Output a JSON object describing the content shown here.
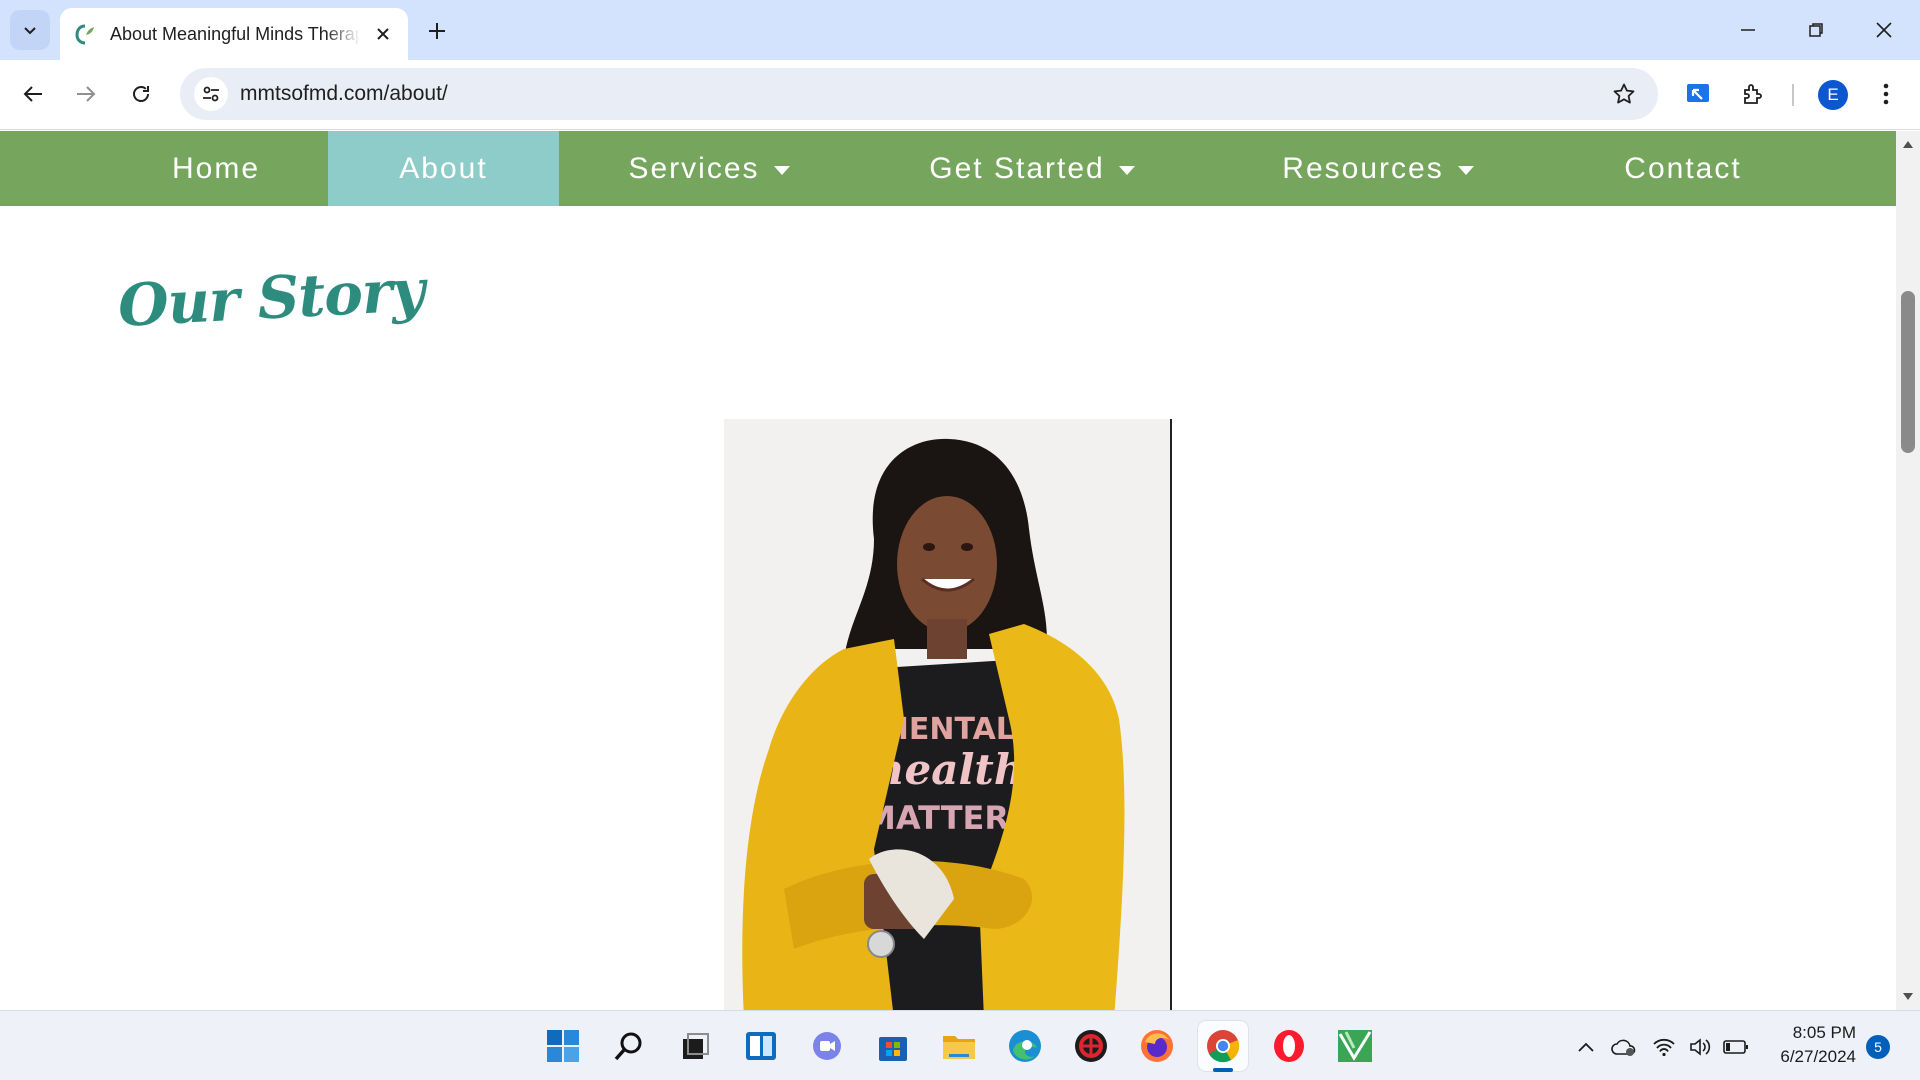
{
  "browser": {
    "tab_title": "About Meaningful Minds Therapy",
    "url": "mmtsofmd.com/about/",
    "profile_initial": "E",
    "accent": "#0b57d0"
  },
  "site": {
    "nav": {
      "items": [
        {
          "label": "Home",
          "active": false,
          "dropdown": false
        },
        {
          "label": "About",
          "active": true,
          "dropdown": false
        },
        {
          "label": "Services",
          "active": false,
          "dropdown": true
        },
        {
          "label": "Get Started",
          "active": false,
          "dropdown": true
        },
        {
          "label": "Resources",
          "active": false,
          "dropdown": true
        },
        {
          "label": "Contact",
          "active": false,
          "dropdown": false
        }
      ],
      "bg_color": "#76a65e",
      "active_color": "#8dccc8"
    },
    "heading": "Our Story",
    "heading_color": "#2e8c7e",
    "photo": {
      "shirt_line1": "MENTAL",
      "shirt_line2": "health",
      "shirt_line3": "MATTERS"
    }
  },
  "taskbar": {
    "time": "8:05 PM",
    "date": "6/27/2024",
    "notification_count": "5",
    "apps": [
      "start-icon",
      "search-icon",
      "task-view-icon",
      "widgets-icon",
      "teams-icon",
      "store-icon",
      "file-explorer-icon",
      "edge-icon",
      "app-red-icon",
      "firefox-icon",
      "chrome-icon",
      "opera-icon",
      "app-green-icon"
    ]
  }
}
